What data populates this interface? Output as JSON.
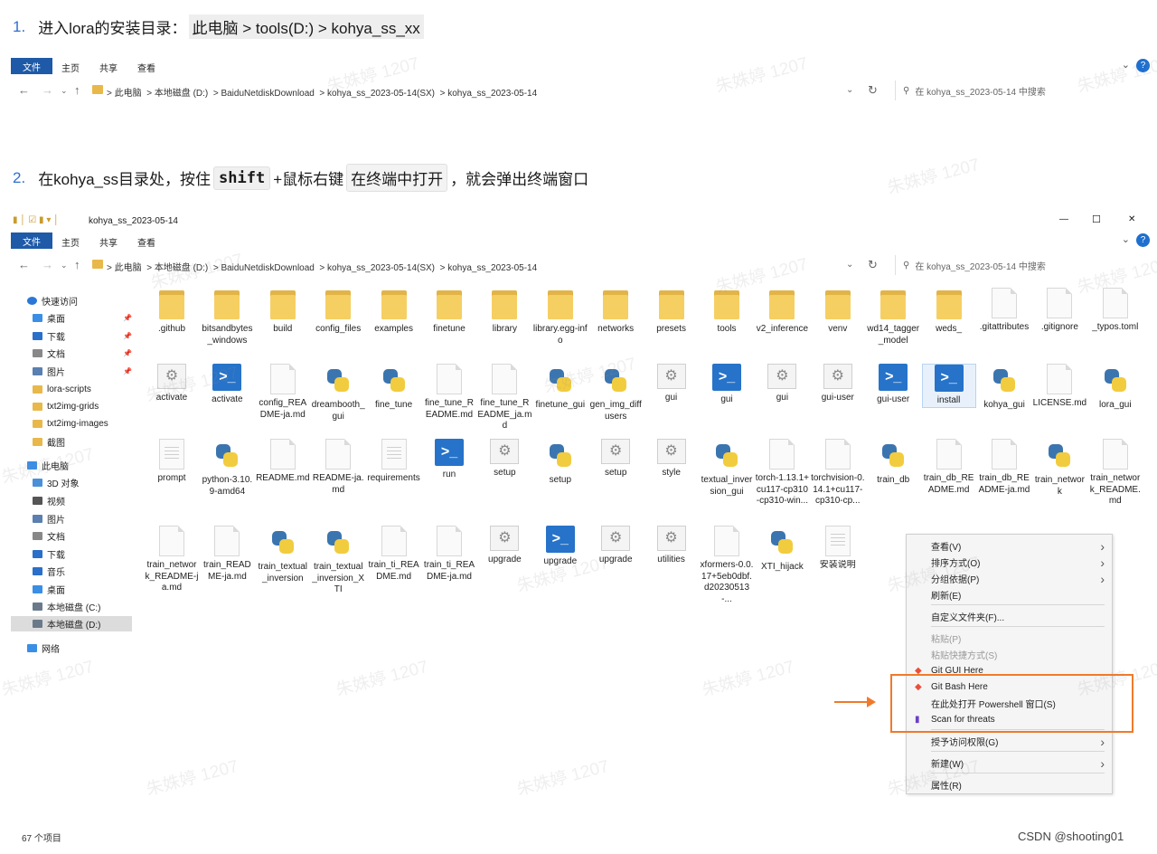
{
  "step1": {
    "num": "1.",
    "text": "进入lora的安装目录：",
    "path": "此电脑 > tools(D:) > kohya_ss_xx"
  },
  "step2": {
    "num": "2.",
    "pre": "在kohya_ss目录处，按住",
    "key": "shift",
    "mid": "+鼠标右键",
    "menu": "在终端中打开",
    "post": "，就会弹出终端窗口"
  },
  "ribbon": {
    "file": "文件",
    "home": "主页",
    "share": "共享",
    "view": "查看",
    "help": "?"
  },
  "address": {
    "crumbs": [
      "此电脑",
      "本地磁盘 (D:)",
      "BaiduNetdiskDownload",
      "kohya_ss_2023-05-14(SX)",
      "kohya_ss_2023-05-14"
    ],
    "sep": ">",
    "search_placeholder": "在 kohya_ss_2023-05-14 中搜索"
  },
  "window": {
    "title": "kohya_ss_2023-05-14",
    "minimize": "—",
    "maximize": "☐",
    "close": "✕"
  },
  "sidebar": [
    {
      "label": "快速访问",
      "icon": "star-icon",
      "color": "#2a78d6"
    },
    {
      "label": "桌面",
      "icon": "desktop-icon",
      "color": "#3a8ee6",
      "pin": true
    },
    {
      "label": "下载",
      "icon": "download-icon",
      "color": "#2a6fc9",
      "pin": true
    },
    {
      "label": "文档",
      "icon": "document-icon",
      "color": "#888888",
      "pin": true
    },
    {
      "label": "图片",
      "icon": "picture-icon",
      "color": "#5a7fb0",
      "pin": true
    },
    {
      "label": "lora-scripts",
      "icon": "folder-icon",
      "color": "#e8b84a"
    },
    {
      "label": "txt2img-grids",
      "icon": "folder-icon",
      "color": "#e8b84a"
    },
    {
      "label": "txt2img-images",
      "icon": "folder-icon",
      "color": "#e8b84a"
    },
    {
      "label": "截图",
      "icon": "folder-icon",
      "color": "#e8b84a"
    },
    {
      "label": "此电脑",
      "icon": "computer-icon",
      "color": "#3a8ee6"
    },
    {
      "label": "3D 对象",
      "icon": "3d-objects-icon",
      "color": "#4a90d9"
    },
    {
      "label": "视频",
      "icon": "video-icon",
      "color": "#555555"
    },
    {
      "label": "图片",
      "icon": "picture-icon",
      "color": "#5a7fb0"
    },
    {
      "label": "文档",
      "icon": "document-icon",
      "color": "#888888"
    },
    {
      "label": "下载",
      "icon": "download-icon",
      "color": "#2a6fc9"
    },
    {
      "label": "音乐",
      "icon": "music-icon",
      "color": "#2a6fc9"
    },
    {
      "label": "桌面",
      "icon": "desktop-icon",
      "color": "#3a8ee6"
    },
    {
      "label": "本地磁盘 (C:)",
      "icon": "drive-icon",
      "color": "#6a7a8a"
    },
    {
      "label": "本地磁盘 (D:)",
      "icon": "drive-icon",
      "color": "#6a7a8a",
      "selected": true
    },
    {
      "label": "网络",
      "icon": "network-icon",
      "color": "#3a8ee6"
    }
  ],
  "files": [
    {
      "name": ".github",
      "type": "folder"
    },
    {
      "name": "bitsandbytes_windows",
      "type": "folder"
    },
    {
      "name": "build",
      "type": "folder"
    },
    {
      "name": "config_files",
      "type": "folder"
    },
    {
      "name": "examples",
      "type": "folder"
    },
    {
      "name": "finetune",
      "type": "folder"
    },
    {
      "name": "library",
      "type": "folder"
    },
    {
      "name": "library.egg-info",
      "type": "folder"
    },
    {
      "name": "networks",
      "type": "folder"
    },
    {
      "name": "presets",
      "type": "folder"
    },
    {
      "name": "tools",
      "type": "folder"
    },
    {
      "name": "v2_inference",
      "type": "folder"
    },
    {
      "name": "venv",
      "type": "folder"
    },
    {
      "name": "wd14_tagger_model",
      "type": "folder"
    },
    {
      "name": "weds_",
      "type": "folder"
    },
    {
      "name": ".gitattributes",
      "type": "doc"
    },
    {
      "name": ".gitignore",
      "type": "doc"
    },
    {
      "name": "_typos.toml",
      "type": "doc"
    },
    {
      "name": "activate",
      "type": "gear"
    },
    {
      "name": "activate",
      "type": "ps"
    },
    {
      "name": "config_README-ja.md",
      "type": "doc"
    },
    {
      "name": "dreambooth_gui",
      "type": "py"
    },
    {
      "name": "fine_tune",
      "type": "py"
    },
    {
      "name": "fine_tune_README.md",
      "type": "doc"
    },
    {
      "name": "fine_tune_README_ja.md",
      "type": "doc"
    },
    {
      "name": "finetune_gui",
      "type": "py"
    },
    {
      "name": "gen_img_diffusers",
      "type": "py"
    },
    {
      "name": "gui",
      "type": "gear"
    },
    {
      "name": "gui",
      "type": "ps"
    },
    {
      "name": "gui",
      "type": "gear"
    },
    {
      "name": "gui-user",
      "type": "gear"
    },
    {
      "name": "gui-user",
      "type": "ps"
    },
    {
      "name": "install",
      "type": "ps",
      "selected": true
    },
    {
      "name": "kohya_gui",
      "type": "py"
    },
    {
      "name": "LICENSE.md",
      "type": "doc"
    },
    {
      "name": "lora_gui",
      "type": "py"
    },
    {
      "name": "prompt",
      "type": "doclines"
    },
    {
      "name": "python-3.10.9-amd64",
      "type": "py"
    },
    {
      "name": "README.md",
      "type": "doc"
    },
    {
      "name": "README-ja.md",
      "type": "doc"
    },
    {
      "name": "requirements",
      "type": "doclines"
    },
    {
      "name": "run",
      "type": "ps"
    },
    {
      "name": "setup",
      "type": "gear"
    },
    {
      "name": "setup",
      "type": "py"
    },
    {
      "name": "setup",
      "type": "gear"
    },
    {
      "name": "style",
      "type": "gear"
    },
    {
      "name": "textual_inversion_gui",
      "type": "py"
    },
    {
      "name": "torch-1.13.1+cu117-cp310-cp310-win...",
      "type": "doc"
    },
    {
      "name": "torchvision-0.14.1+cu117-cp310-cp...",
      "type": "doc"
    },
    {
      "name": "train_db",
      "type": "py"
    },
    {
      "name": "train_db_README.md",
      "type": "doc"
    },
    {
      "name": "train_db_README-ja.md",
      "type": "doc"
    },
    {
      "name": "train_network",
      "type": "py"
    },
    {
      "name": "train_network_README.md",
      "type": "doc"
    },
    {
      "name": "train_network_README-ja.md",
      "type": "doc"
    },
    {
      "name": "train_README-ja.md",
      "type": "doc"
    },
    {
      "name": "train_textual_inversion",
      "type": "py"
    },
    {
      "name": "train_textual_inversion_XTI",
      "type": "py"
    },
    {
      "name": "train_ti_README.md",
      "type": "doc"
    },
    {
      "name": "train_ti_README-ja.md",
      "type": "doc"
    },
    {
      "name": "upgrade",
      "type": "gear"
    },
    {
      "name": "upgrade",
      "type": "ps"
    },
    {
      "name": "upgrade",
      "type": "gear"
    },
    {
      "name": "utilities",
      "type": "gear"
    },
    {
      "name": "xformers-0.0.17+5eb0dbf.d20230513-...",
      "type": "doc"
    },
    {
      "name": "XTI_hijack",
      "type": "py"
    },
    {
      "name": "安装说明",
      "type": "doclines"
    }
  ],
  "context_menu": [
    {
      "label": "查看(V)",
      "arrow": true
    },
    {
      "label": "排序方式(O)",
      "arrow": true
    },
    {
      "label": "分组依据(P)",
      "arrow": true
    },
    {
      "label": "刷新(E)"
    },
    {
      "sep": true
    },
    {
      "label": "自定义文件夹(F)..."
    },
    {
      "sep": true
    },
    {
      "label": "粘贴(P)",
      "disabled": true
    },
    {
      "label": "粘贴快捷方式(S)",
      "disabled": true
    },
    {
      "label": "Git GUI Here",
      "icon": "git-icon"
    },
    {
      "label": "Git Bash Here",
      "icon": "git-icon"
    },
    {
      "label": "在此处打开 Powershell 窗口(S)"
    },
    {
      "label": "Scan for threats",
      "icon": "shield-icon"
    },
    {
      "sep": true
    },
    {
      "label": "授予访问权限(G)",
      "arrow": true
    },
    {
      "sep": true
    },
    {
      "label": "新建(W)",
      "arrow": true
    },
    {
      "sep": true
    },
    {
      "label": "属性(R)"
    }
  ],
  "status": {
    "count": "67 个项目"
  },
  "footer": {
    "csdn": "CSDN @shooting01"
  },
  "watermark": {
    "text": "朱姝婷 1207"
  },
  "colors": {
    "accent": "#1e5aa8",
    "highlight": "#f07a2a",
    "step_number": "#2f6fd0"
  }
}
